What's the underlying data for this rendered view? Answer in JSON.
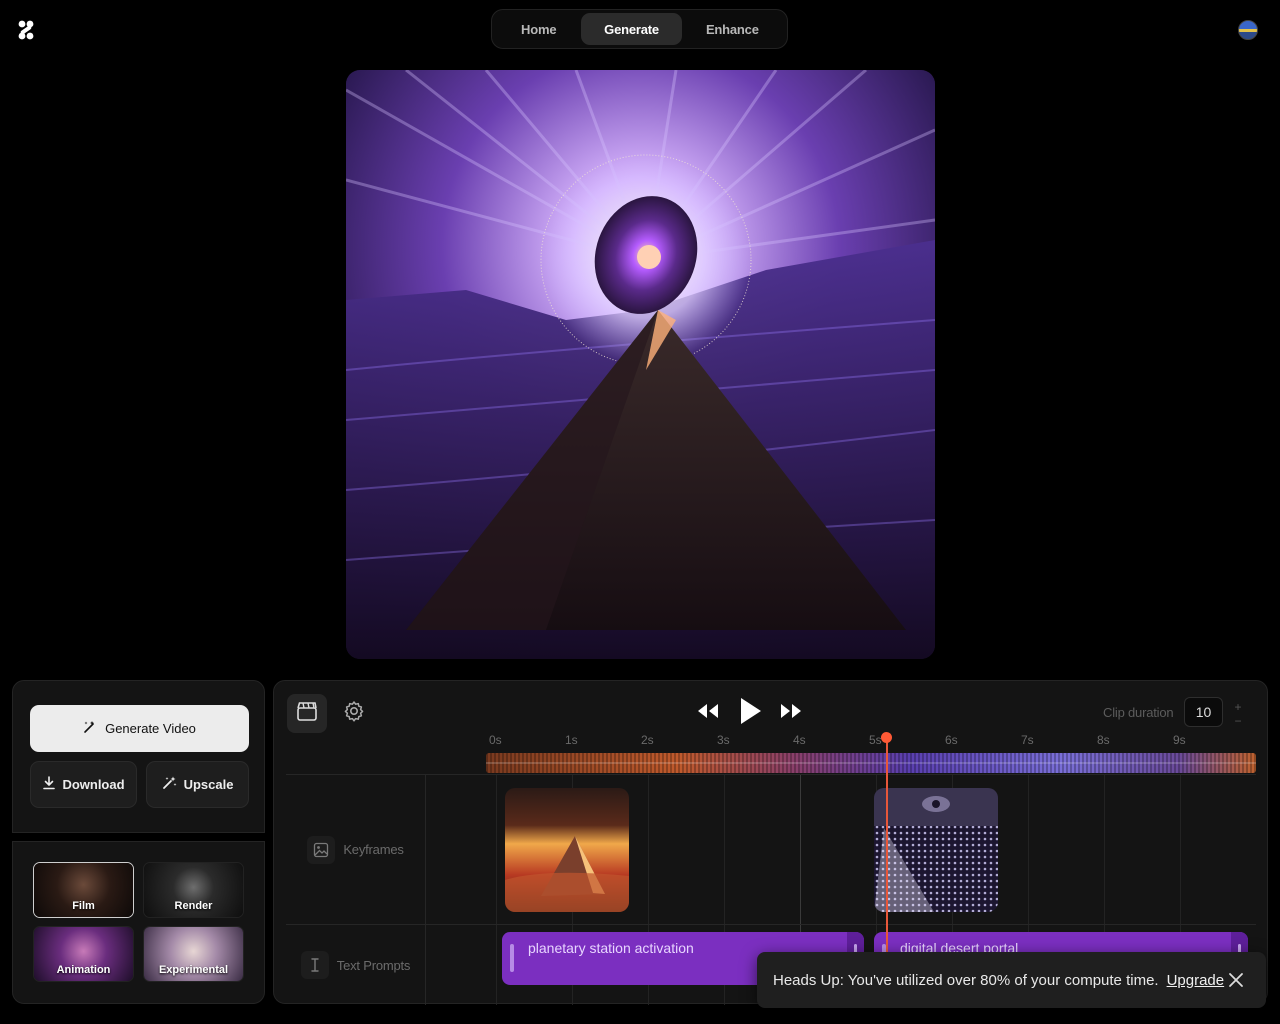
{
  "nav": {
    "tabs": [
      {
        "label": "Home",
        "active": false
      },
      {
        "label": "Generate",
        "active": true
      },
      {
        "label": "Enhance",
        "active": false
      }
    ]
  },
  "icons": {
    "logo": "app-logo-icon",
    "avatar": "user-avatar",
    "generate": "magic-wand-icon",
    "download": "download-icon",
    "upscale": "sparkle-wand-icon",
    "clapper": "clapperboard-icon",
    "settings": "gear-icon",
    "rewind": "rewind-icon",
    "play": "play-icon",
    "forward": "fast-forward-icon",
    "keyframes": "image-icon",
    "text_prompts": "text-cursor-icon",
    "close": "close-icon"
  },
  "actions": {
    "generate_video": "Generate Video",
    "download": "Download",
    "upscale": "Upscale"
  },
  "styles": [
    {
      "label": "Film",
      "selected": true
    },
    {
      "label": "Render",
      "selected": false
    },
    {
      "label": "Animation",
      "selected": false
    },
    {
      "label": "Experimental",
      "selected": false
    }
  ],
  "timeline": {
    "clip_duration_label": "Clip duration",
    "clip_duration_value": "10",
    "increment": "+",
    "decrement": "−",
    "ticks": [
      "0s",
      "1s",
      "2s",
      "3s",
      "4s",
      "5s",
      "6s",
      "7s",
      "8s",
      "9s"
    ],
    "playhead_seconds": 5.15,
    "tracks": {
      "keyframes_label": "Keyframes",
      "text_prompts_label": "Text Prompts"
    },
    "text_prompts": [
      {
        "text": "planetary station activation"
      },
      {
        "text": "digital desert portal"
      }
    ]
  },
  "toast": {
    "message": "Heads Up: You've utilized over 80% of your compute time.",
    "link": "Upgrade"
  },
  "colors": {
    "accent_purple": "#7b2fc0",
    "playhead": "#ff5a36",
    "background": "#000000",
    "panel": "#141414"
  }
}
